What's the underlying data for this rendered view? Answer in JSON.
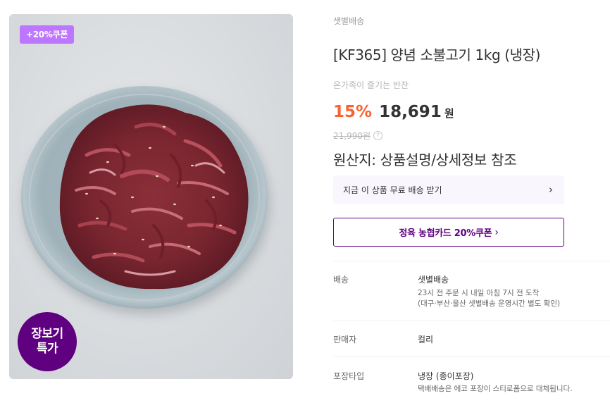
{
  "image": {
    "coupon_tag": "+20%쿠폰",
    "sale_badge_line1": "장보기",
    "sale_badge_line2": "특가"
  },
  "product": {
    "delivery_type": "샛별배송",
    "title": "[KF365] 양념 소불고기 1kg (냉장)",
    "subtitle": "온가족이 즐기는 반찬",
    "discount_rate": "15%",
    "price": "18,691",
    "currency": "원",
    "original_price": "21,990원",
    "help_icon": "?",
    "origin": "원산지: 상품설명/상세정보 참조"
  },
  "actions": {
    "free_shipping": "지금 이 상품 무료 배송 받기",
    "chevron": "›",
    "card_coupon": "정육 농협카드 20%쿠폰",
    "card_coupon_chevron": "›"
  },
  "details": [
    {
      "label": "배송",
      "value": "샛별배송",
      "sub1": "23시 전 주문 시 내일 아침 7시 전 도착",
      "sub2": "(대구·부산·울산 샛별배송 운영시간 별도 확인)"
    },
    {
      "label": "판매자",
      "value": "컬리"
    },
    {
      "label": "포장타입",
      "value": "냉장 (종이포장)",
      "sub1": "택배배송은 에코 포장이 스티로폼으로 대체됩니다."
    }
  ],
  "colors": {
    "brand_purple": "#5f0080",
    "coupon_tag": "#bd76ff",
    "discount": "#fa622f"
  }
}
